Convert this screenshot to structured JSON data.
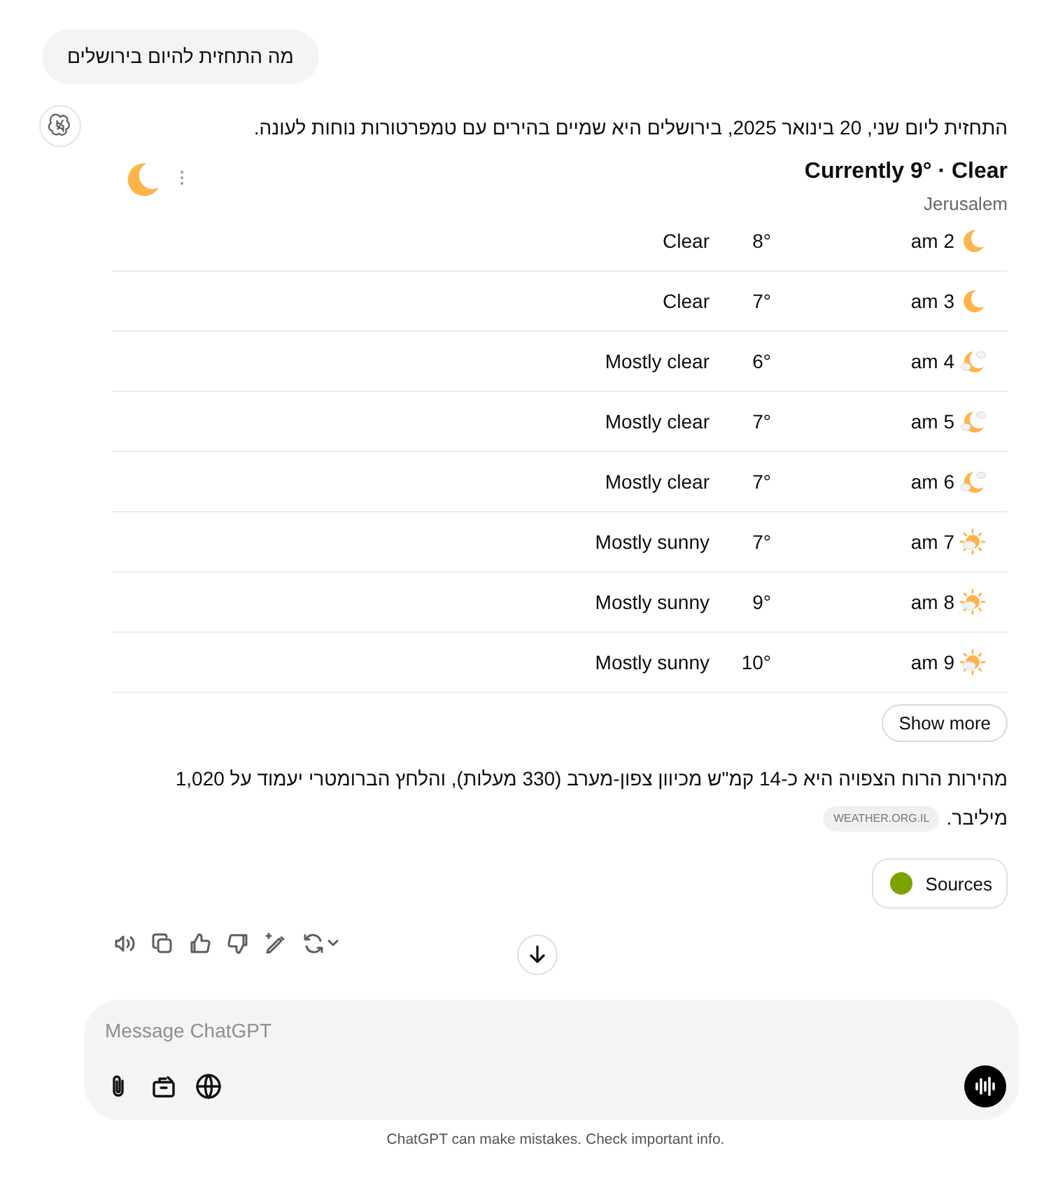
{
  "user_message": "מה התחזית להיום בירושלים",
  "assistant": {
    "intro": "התחזית ליום שני, 20 בינואר 2025, בירושלים היא שמיים בהירים עם טמפרטורות נוחות לעונה.",
    "weather": {
      "current": "Currently 9° · Clear",
      "current_icon": {
        "kind": "moon"
      },
      "location": "Jerusalem",
      "hours": [
        {
          "time": "2 am",
          "kind": "moon",
          "temp": "8°",
          "condition": "Clear"
        },
        {
          "time": "3 am",
          "kind": "moon",
          "temp": "7°",
          "condition": "Clear"
        },
        {
          "time": "4 am",
          "kind": "moon-cloud",
          "temp": "6°",
          "condition": "Mostly clear"
        },
        {
          "time": "5 am",
          "kind": "moon-cloud",
          "temp": "7°",
          "condition": "Mostly clear"
        },
        {
          "time": "6 am",
          "kind": "moon-cloud",
          "temp": "7°",
          "condition": "Mostly clear"
        },
        {
          "time": "7 am",
          "kind": "sun-cloud",
          "temp": "7°",
          "condition": "Mostly sunny"
        },
        {
          "time": "8 am",
          "kind": "sun-cloud",
          "temp": "9°",
          "condition": "Mostly sunny"
        },
        {
          "time": "9 am",
          "kind": "sun-cloud",
          "temp": "10°",
          "condition": "Mostly sunny"
        }
      ],
      "show_more": "Show more"
    },
    "wind_text": "מהירות הרוח הצפויה היא כ-14 קמ\"ש מכיוון צפון-מערב (330 מעלות), והלחץ הברומטרי יעמוד על 1,020 מיליבר.",
    "source_chip": "WEATHER.ORG.IL",
    "sources_button": "Sources"
  },
  "composer": {
    "placeholder": "Message ChatGPT"
  },
  "footer": "ChatGPT can make mistakes. Check important info."
}
